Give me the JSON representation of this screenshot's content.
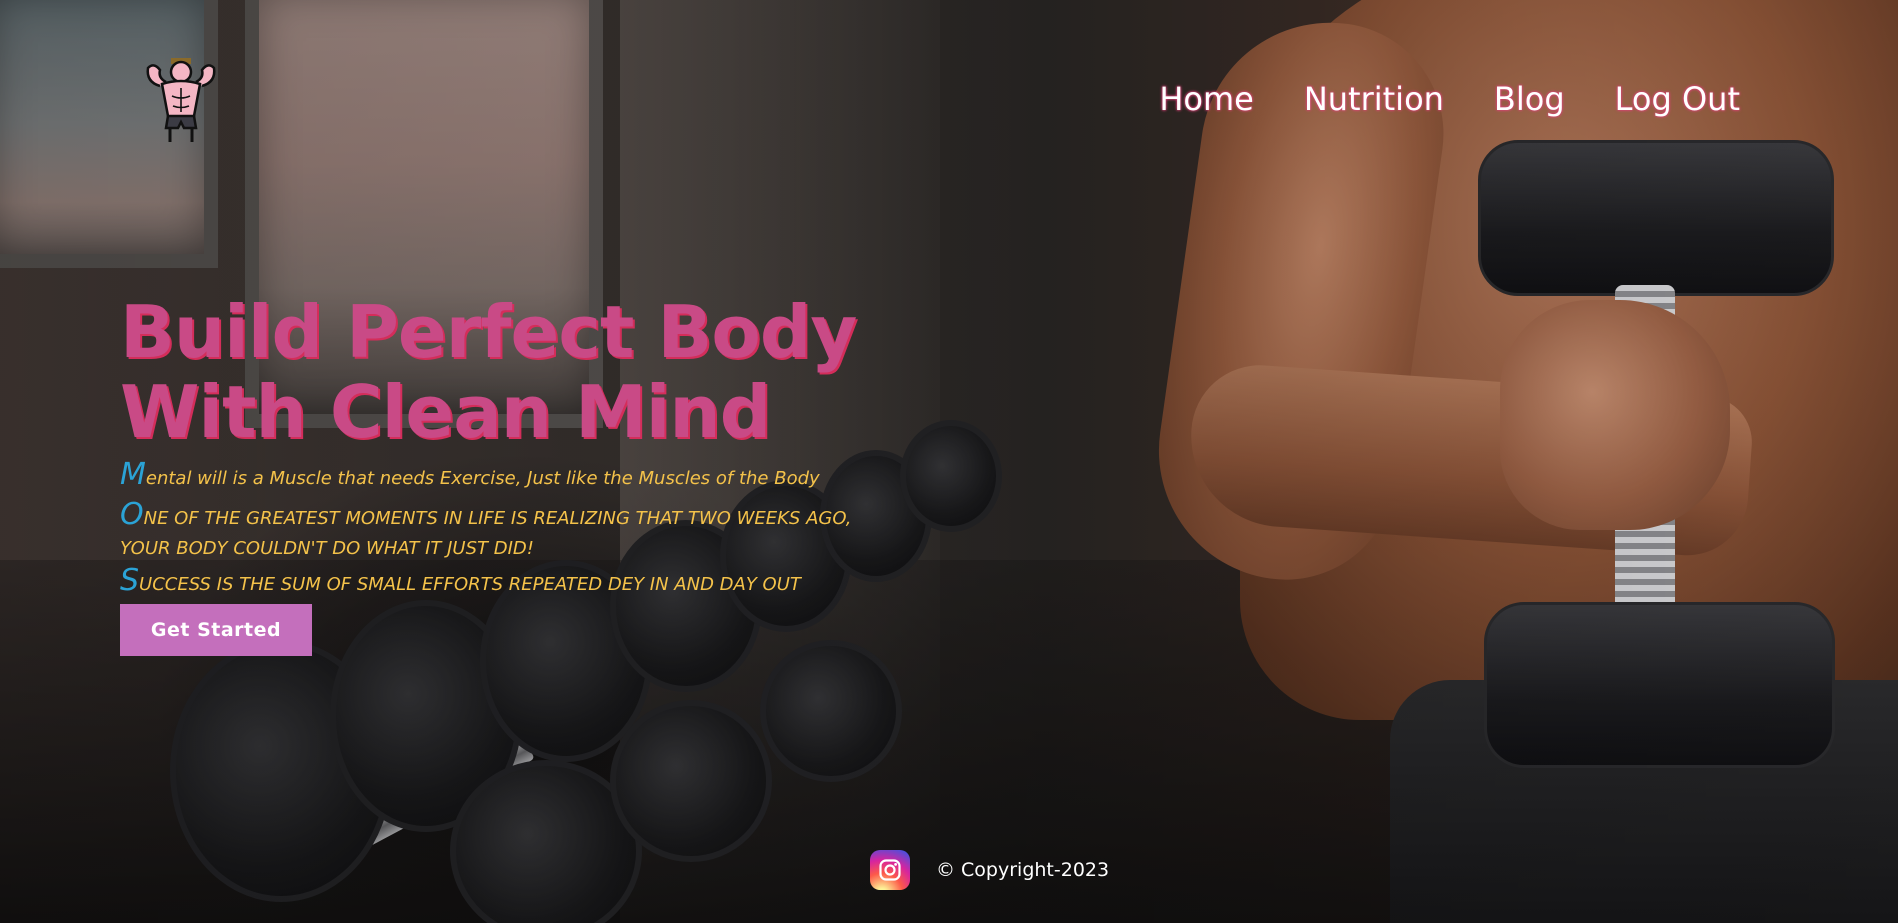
{
  "header": {
    "logo_icon": "bodybuilder-flexing-icon",
    "nav": [
      {
        "label": "Home"
      },
      {
        "label": "Nutrition"
      },
      {
        "label": "Blog"
      },
      {
        "label": "Log Out"
      }
    ]
  },
  "hero": {
    "title_line1": "Build Perfect Body",
    "title_line2": "With Clean Mind",
    "quotes": [
      {
        "initial": "M",
        "rest": "ental will is a Muscle that needs Exercise, Just like the Muscles of the Body"
      },
      {
        "initial": "O",
        "rest": "ne of the greatest moments in life is realizing that two weeks ago, your body couldn't do what it just did!"
      },
      {
        "initial": "S",
        "rest": "uccess is the sum of small efforts repeated dey in and day out"
      }
    ],
    "cta_label": "Get Started"
  },
  "footer": {
    "social_icon": "instagram-icon",
    "copyright": "© Copyright-2023"
  },
  "colors": {
    "title": "#c94a86",
    "quote": "#f4c24a",
    "initial": "#2ba3d6",
    "cta_bg": "#c46fbc",
    "nav_glow": "#e0417a"
  }
}
